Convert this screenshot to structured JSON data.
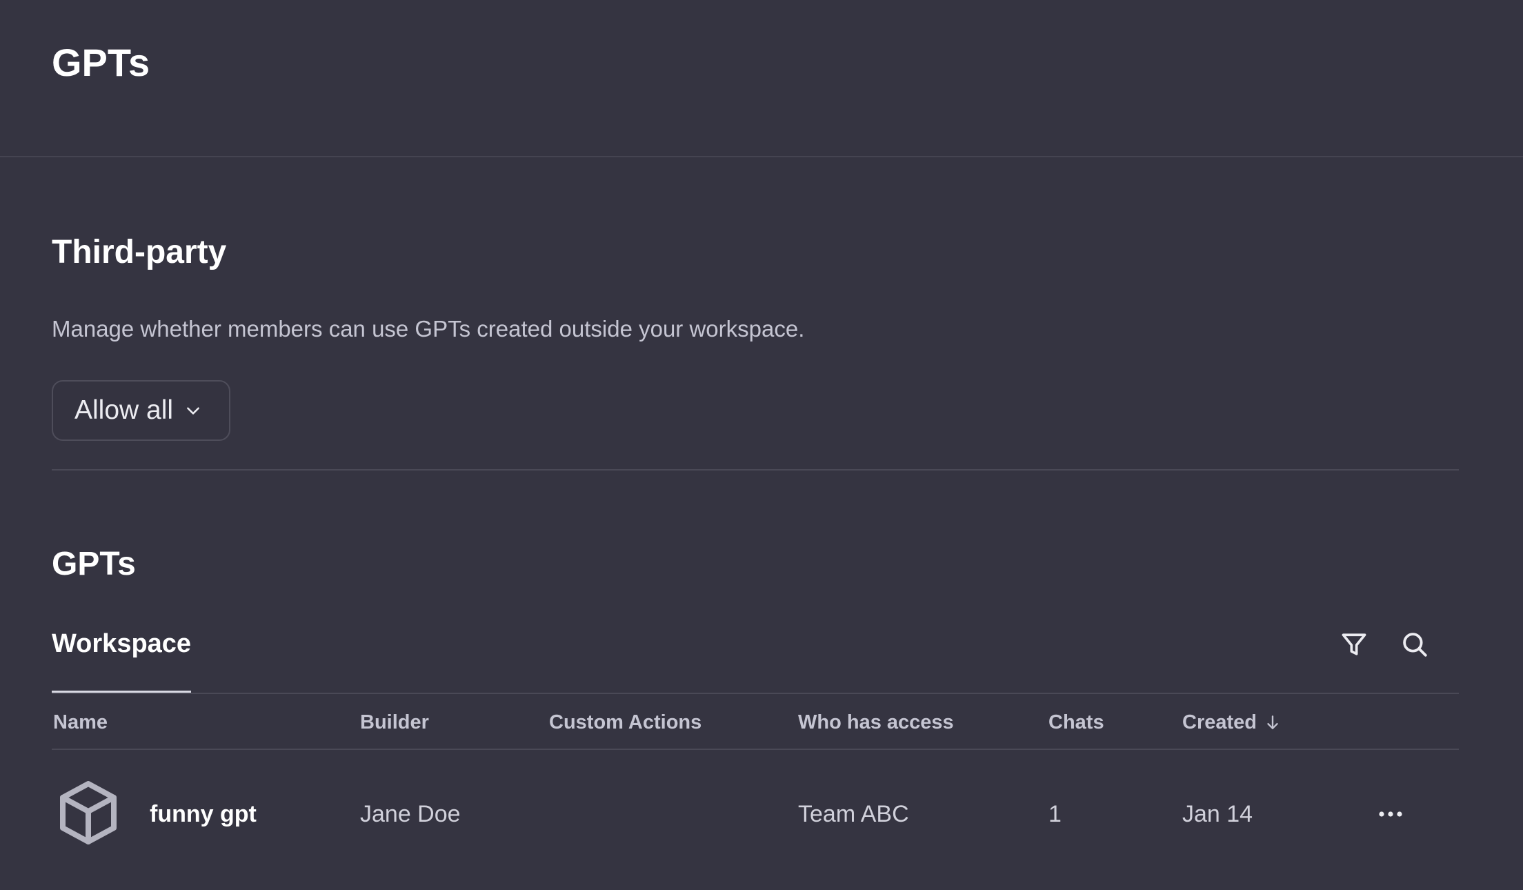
{
  "header": {
    "title": "GPTs"
  },
  "third_party": {
    "title": "Third-party",
    "description": "Manage whether members can use GPTs created outside your workspace.",
    "select_value": "Allow all"
  },
  "gpts": {
    "title": "GPTs",
    "tabs": [
      {
        "label": "Workspace",
        "active": true
      }
    ],
    "toolbar_icons": [
      "filter-icon",
      "search-icon"
    ],
    "columns": [
      "Name",
      "Builder",
      "Custom Actions",
      "Who has access",
      "Chats",
      "Created"
    ],
    "sort_column": "Created",
    "sort_direction": "descending",
    "rows": [
      {
        "icon": "cube-icon",
        "name": "funny gpt",
        "builder": "Jane Doe",
        "custom_actions": "",
        "access": "Team ABC",
        "chats": "1",
        "created": "Jan 14"
      }
    ]
  },
  "colors": {
    "background": "#353441",
    "divider": "#4a4956",
    "text_primary": "#ffffff",
    "text_secondary": "#c5c5d2"
  }
}
